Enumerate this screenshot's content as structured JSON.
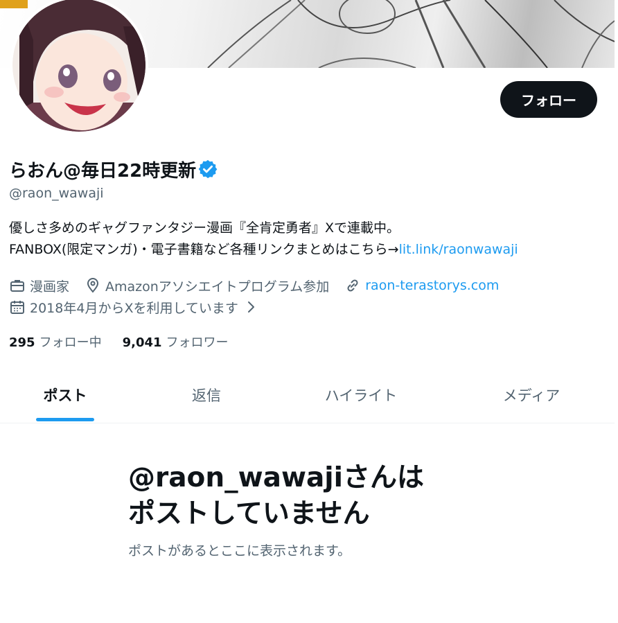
{
  "profile": {
    "display_name": "らおん@毎日22時更新",
    "handle": "@raon_wawaji",
    "follow_label": "フォロー",
    "bio_line1": "優しさ多めのギャグファンタジー漫画『全肯定勇者』Xで連載中。",
    "bio_line2_text": "FANBOX(限定マンガ)・電子書籍など各種リンクまとめはこちら→",
    "bio_line2_link": "lit.link/raonwawaji",
    "category": "漫画家",
    "location": "Amazonアソシエイトプログラム参加",
    "website": "raon-terastorys.com",
    "joined": "2018年4月からXを利用しています",
    "following_count": "295",
    "following_label": "フォロー中",
    "followers_count": "9,041",
    "followers_label": "フォロワー"
  },
  "tabs": [
    {
      "label": "ポスト",
      "active": true
    },
    {
      "label": "返信",
      "active": false
    },
    {
      "label": "ハイライト",
      "active": false
    },
    {
      "label": "メディア",
      "active": false
    }
  ],
  "empty_state": {
    "title_line1": "@raon_wawajiさんは",
    "title_line2": "ポストしていません",
    "subtitle": "ポストがあるとここに表示されます。"
  },
  "icons": [
    "verified-badge-icon",
    "briefcase-icon",
    "location-pin-icon",
    "link-icon",
    "calendar-icon",
    "chevron-right-icon"
  ],
  "colors": {
    "accent": "#1d9bf0",
    "text_primary": "#0f1419",
    "text_secondary": "#536471",
    "button_bg": "#0f1419"
  }
}
